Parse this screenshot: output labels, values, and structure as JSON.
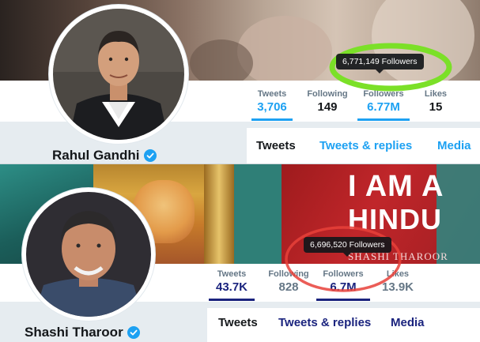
{
  "profiles": [
    {
      "name": "Rahul Gandhi",
      "verified": true,
      "stats": [
        {
          "label": "Tweets",
          "value": "3,706"
        },
        {
          "label": "Following",
          "value": "149"
        },
        {
          "label": "Followers",
          "value": "6.77M"
        },
        {
          "label": "Likes",
          "value": "15"
        }
      ],
      "followers_tooltip": "6,771,149 Followers",
      "tabs": [
        "Tweets",
        "Tweets & replies",
        "Media"
      ],
      "accent_color": "#1da1f2",
      "highlight_color": "#7be028"
    },
    {
      "name": "Shashi Tharoor",
      "verified": true,
      "stats": [
        {
          "label": "Tweets",
          "value": "43.7K"
        },
        {
          "label": "Following",
          "value": "828"
        },
        {
          "label": "Followers",
          "value": "6.7M"
        },
        {
          "label": "Likes",
          "value": "13.9K"
        }
      ],
      "followers_tooltip": "6,696,520 Followers",
      "tabs": [
        "Tweets",
        "Tweets & replies",
        "Media"
      ],
      "accent_color": "#1a237e",
      "highlight_color": "#e8413a",
      "banner": {
        "line1": "I AM A",
        "line2": "HINDU",
        "byline": "SHASHI THAROOR"
      }
    }
  ]
}
